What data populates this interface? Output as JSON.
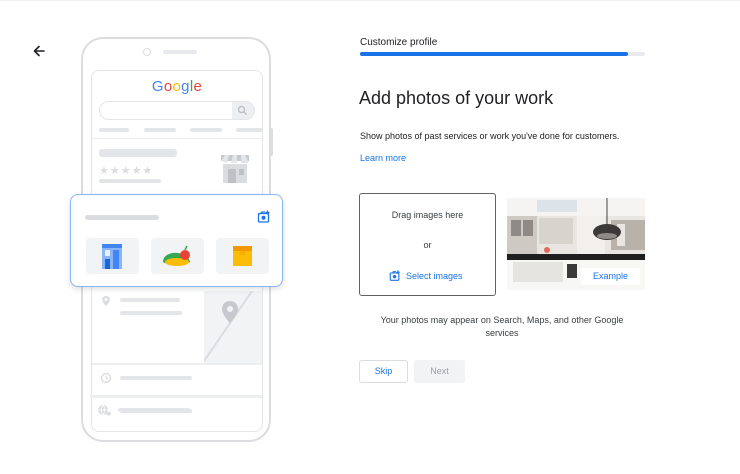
{
  "header": {
    "step_label": "Customize profile",
    "progress_fraction": 0.94
  },
  "illustration": {
    "logo_text": "Google",
    "logo_colors": [
      "#4285f4",
      "#ea4335",
      "#fbbc05",
      "#4285f4",
      "#34a853",
      "#ea4335"
    ],
    "stars": "★★★★★"
  },
  "main": {
    "heading": "Add photos of your work",
    "description": "Show photos of past services or work you've done for customers.",
    "learn_more": "Learn more"
  },
  "upload": {
    "drag_text": "Drag images here",
    "or_text": "or",
    "select_label": "Select images",
    "example_label": "Example"
  },
  "note": "Your photos may appear on Search, Maps, and other Google services",
  "actions": {
    "skip_label": "Skip",
    "next_label": "Next"
  },
  "colors": {
    "accent": "#1a73e8",
    "card_border": "#8ab4f8",
    "disabled_bg": "#f1f3f4"
  },
  "icons": [
    "back-arrow-icon",
    "add-photo-icon",
    "search-icon",
    "store-icon",
    "location-pin-icon",
    "clock-icon",
    "phone-icon",
    "globe-icon",
    "map-pin-icon"
  ]
}
